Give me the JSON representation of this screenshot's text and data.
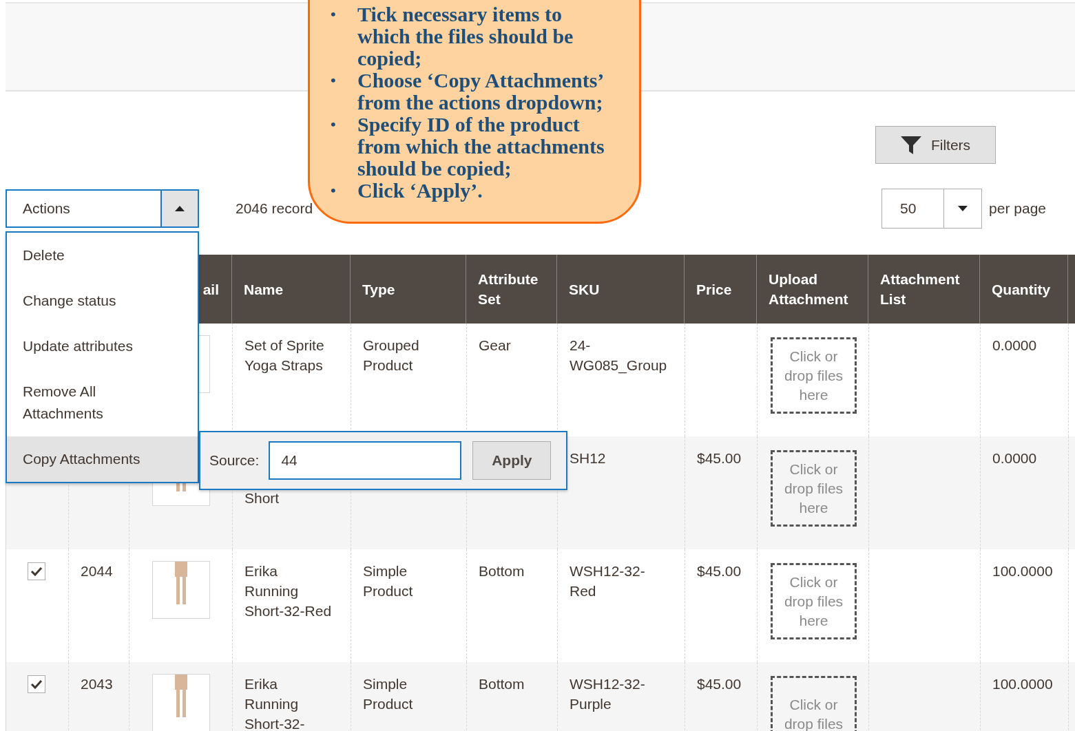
{
  "callout": {
    "bullet": "•",
    "items": [
      "Tick necessary items to\nwhich the files should be\ncopied;",
      "Choose ‘Copy Attachments’\nfrom the actions dropdown;",
      "Specify ID of the product\nfrom which the attachments\nshould be copied;",
      "Click ‘Apply’."
    ]
  },
  "filters_button": {
    "label": "Filters"
  },
  "actions": {
    "label": "Actions",
    "expanded": true,
    "menu": [
      {
        "label": "Delete",
        "selected": false
      },
      {
        "label": "Change status",
        "selected": false
      },
      {
        "label": "Update attributes",
        "selected": false
      },
      {
        "label": "Remove All\nAttachments",
        "selected": false
      },
      {
        "label": "Copy Attachments",
        "selected": true
      }
    ]
  },
  "copy_popup": {
    "label": "Source:",
    "value": "44",
    "button": "Apply"
  },
  "records_found": "2046 record",
  "per_page": {
    "value": "50",
    "label": "per page"
  },
  "table": {
    "columns": [
      {
        "kind": "select"
      },
      {
        "kind": "text"
      },
      {
        "kind": "photo",
        "label": "ail"
      },
      {
        "kind": "text",
        "label": "Name"
      },
      {
        "kind": "text",
        "label": "Type"
      },
      {
        "kind": "text",
        "label": "Attribute\nSet"
      },
      {
        "kind": "text",
        "label": "SKU"
      },
      {
        "kind": "text",
        "label": "Price"
      },
      {
        "kind": "dropzone",
        "label": "Upload\nAttachment"
      },
      {
        "kind": "text",
        "label": "Attachment\nList"
      },
      {
        "kind": "text",
        "label": "Quantity"
      },
      {
        "kind": "blank"
      }
    ],
    "rows": [
      {
        "name": "Set of Sprite\nYoga Straps",
        "type": "Grouped\nProduct",
        "attribute_set": "Gear",
        "sku": "24-\nWG085_Group",
        "upload": "Click or\ndrop files\nhere",
        "quantity": "0.0000"
      },
      {
        "name": "Short",
        "sku": "SH12",
        "price": "$45.00",
        "upload": "Click or\ndrop files\nhere",
        "quantity": "0.0000"
      },
      {
        "checked": true,
        "id": "2044",
        "name": "Erika\nRunning\nShort-32-Red",
        "type": "Simple\nProduct",
        "attribute_set": "Bottom",
        "sku": "WSH12-32-\nRed",
        "price": "$45.00",
        "upload": "Click or\ndrop files\nhere",
        "quantity": "100.0000"
      },
      {
        "checked": true,
        "id": "2043",
        "name": "Erika\nRunning\nShort-32-",
        "type": "Simple\nProduct",
        "attribute_set": "Bottom",
        "sku": "WSH12-32-\nPurple",
        "price": "$45.00",
        "upload": "Click or\ndrop files",
        "quantity": "100.0000"
      }
    ]
  }
}
